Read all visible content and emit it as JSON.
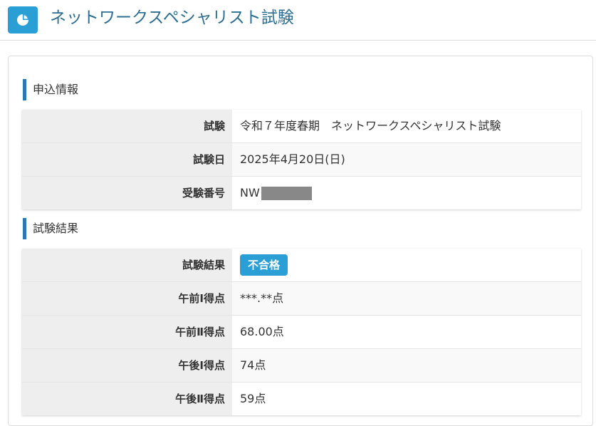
{
  "header": {
    "title": "ネットワークスペシャリスト試験",
    "icon": "pie-chart-icon",
    "accent_color": "#2a9fd6"
  },
  "application_info": {
    "heading": "申込情報",
    "rows": [
      {
        "label": "試験",
        "value": "令和７年度春期　ネットワークスペシャリスト試験"
      },
      {
        "label": "試験日",
        "value": "2025年4月20日(日)"
      },
      {
        "label": "受験番号",
        "value": "NW"
      }
    ]
  },
  "exam_result": {
    "heading": "試験結果",
    "result_label": "試験結果",
    "result_badge": "不合格",
    "rows": [
      {
        "label": "午前Ⅰ得点",
        "value": "***.**点"
      },
      {
        "label": "午前Ⅱ得点",
        "value": "68.00点"
      },
      {
        "label": "午後Ⅰ得点",
        "value": "74点"
      },
      {
        "label": "午後Ⅱ得点",
        "value": "59点"
      }
    ]
  }
}
